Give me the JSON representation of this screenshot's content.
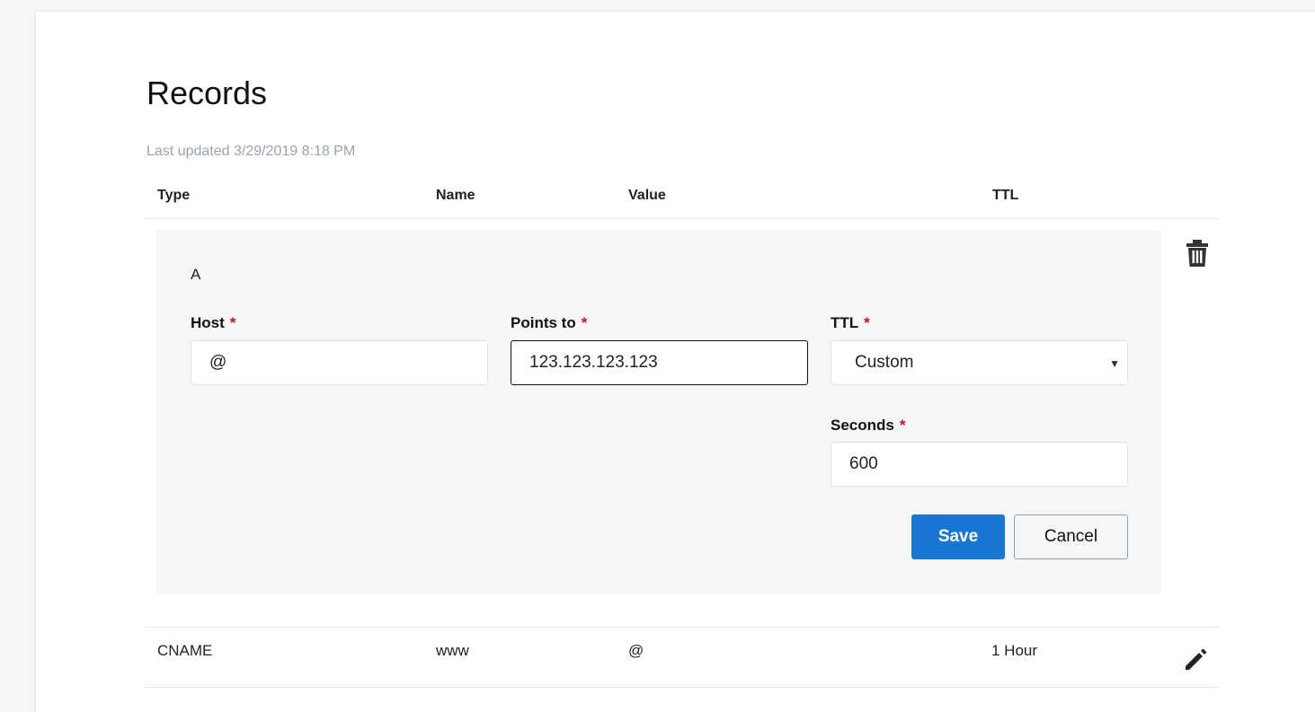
{
  "page": {
    "title": "Records",
    "last_updated": "Last updated 3/29/2019 8:18 PM"
  },
  "table": {
    "headers": [
      "Type",
      "Name",
      "Value",
      "TTL"
    ]
  },
  "editing_record": {
    "type": "A",
    "host_label": "Host",
    "host_value": "@",
    "points_to_label": "Points to",
    "points_to_value": "123.123.123.123",
    "ttl_label": "TTL",
    "ttl_value": "Custom",
    "seconds_label": "Seconds",
    "seconds_value": "600",
    "required_mark": "*",
    "save_label": "Save",
    "cancel_label": "Cancel",
    "delete_icon": "trash-icon"
  },
  "rows": [
    {
      "type": "CNAME",
      "name": "www",
      "value": "@",
      "ttl": "1 Hour",
      "edit_icon": "pencil-icon"
    }
  ],
  "colors": {
    "accent": "#1976d2",
    "required": "#d0101b",
    "muted_text": "#9aa3ad",
    "panel_bg": "#f5f6f7"
  }
}
